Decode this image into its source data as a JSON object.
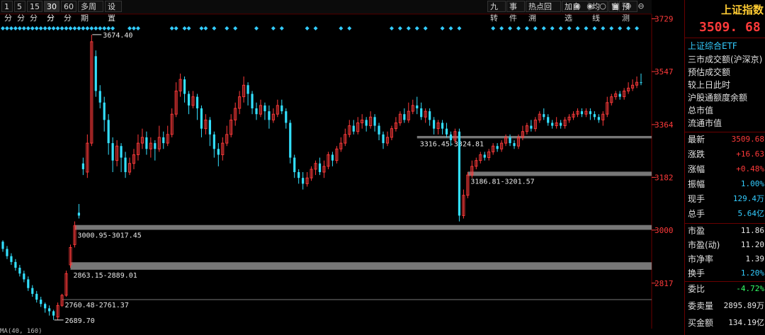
{
  "toolbar": {
    "periods": [
      "1分",
      "5分",
      "15分",
      "30分",
      "60分",
      "多周期",
      "设置"
    ],
    "right_tabs": [
      "九转",
      "事件",
      "热点回溯",
      "加自选",
      "均线",
      "窗",
      "预测"
    ],
    "icons": [
      "circle-dot-icon",
      "eye-icon",
      "circle-icon",
      "trash-icon",
      "plus-circle-icon",
      "minus-circle-icon"
    ]
  },
  "bottom_strip": "MA(40, 160)",
  "chart_data": {
    "type": "candlestick",
    "y_axis_ticks": [
      3729,
      3547,
      3364,
      3182,
      3000,
      2817
    ],
    "ylim": [
      2660,
      3745
    ],
    "candles": [
      [
        2960,
        2935,
        2965,
        2925
      ],
      [
        2935,
        2910,
        2945,
        2900
      ],
      [
        2910,
        2890,
        2920,
        2880
      ],
      [
        2890,
        2870,
        2900,
        2860
      ],
      [
        2870,
        2850,
        2880,
        2840
      ],
      [
        2850,
        2830,
        2860,
        2820
      ],
      [
        2830,
        2800,
        2840,
        2790
      ],
      [
        2800,
        2780,
        2810,
        2770
      ],
      [
        2780,
        2760,
        2790,
        2750
      ],
      [
        2760,
        2745,
        2770,
        2735
      ],
      [
        2745,
        2730,
        2750,
        2715
      ],
      [
        2730,
        2720,
        2740,
        2705
      ],
      [
        2720,
        2705,
        2725,
        2690
      ],
      [
        2700,
        2740,
        2750,
        2690
      ],
      [
        2740,
        2775,
        2780,
        2735
      ],
      [
        2775,
        2850,
        2860,
        2770
      ],
      [
        2880,
        2940,
        2950,
        2870
      ],
      [
        2950,
        3015,
        3030,
        2940
      ],
      [
        3060,
        3050,
        3090,
        3040
      ],
      [
        3230,
        3210,
        3250,
        3190
      ],
      [
        3200,
        3300,
        3330,
        3180
      ],
      [
        3300,
        3650,
        3674,
        3290
      ],
      [
        3600,
        3480,
        3620,
        3460
      ],
      [
        3480,
        3440,
        3500,
        3420
      ],
      [
        3440,
        3380,
        3460,
        3340
      ],
      [
        3380,
        3300,
        3400,
        3260
      ],
      [
        3300,
        3240,
        3320,
        3200
      ],
      [
        3240,
        3290,
        3310,
        3220
      ],
      [
        3290,
        3250,
        3300,
        3200
      ],
      [
        3250,
        3200,
        3270,
        3180
      ],
      [
        3200,
        3230,
        3250,
        3190
      ],
      [
        3230,
        3260,
        3280,
        3210
      ],
      [
        3260,
        3300,
        3330,
        3240
      ],
      [
        3300,
        3320,
        3350,
        3280
      ],
      [
        3320,
        3280,
        3340,
        3260
      ],
      [
        3280,
        3300,
        3320,
        3250
      ],
      [
        3300,
        3280,
        3310,
        3240
      ],
      [
        3280,
        3320,
        3360,
        3270
      ],
      [
        3320,
        3300,
        3340,
        3280
      ],
      [
        3300,
        3330,
        3360,
        3290
      ],
      [
        3330,
        3400,
        3420,
        3320
      ],
      [
        3400,
        3480,
        3510,
        3390
      ],
      [
        3480,
        3520,
        3540,
        3460
      ],
      [
        3520,
        3470,
        3530,
        3440
      ],
      [
        3470,
        3430,
        3480,
        3400
      ],
      [
        3430,
        3460,
        3480,
        3420
      ],
      [
        3460,
        3420,
        3470,
        3380
      ],
      [
        3420,
        3350,
        3430,
        3320
      ],
      [
        3350,
        3380,
        3400,
        3330
      ],
      [
        3380,
        3330,
        3390,
        3290
      ],
      [
        3330,
        3280,
        3340,
        3250
      ],
      [
        3280,
        3260,
        3300,
        3220
      ],
      [
        3260,
        3300,
        3320,
        3240
      ],
      [
        3300,
        3330,
        3360,
        3290
      ],
      [
        3330,
        3380,
        3400,
        3320
      ],
      [
        3380,
        3420,
        3440,
        3360
      ],
      [
        3420,
        3460,
        3480,
        3400
      ],
      [
        3460,
        3500,
        3530,
        3440
      ],
      [
        3500,
        3470,
        3510,
        3430
      ],
      [
        3470,
        3420,
        3480,
        3400
      ],
      [
        3420,
        3400,
        3440,
        3380
      ],
      [
        3400,
        3430,
        3450,
        3390
      ],
      [
        3430,
        3410,
        3440,
        3380
      ],
      [
        3410,
        3380,
        3430,
        3350
      ],
      [
        3380,
        3400,
        3420,
        3370
      ],
      [
        3400,
        3430,
        3450,
        3390
      ],
      [
        3430,
        3410,
        3450,
        3400
      ],
      [
        3410,
        3370,
        3420,
        3350
      ],
      [
        3370,
        3250,
        3380,
        3230
      ],
      [
        3250,
        3200,
        3260,
        3180
      ],
      [
        3200,
        3180,
        3210,
        3160
      ],
      [
        3180,
        3160,
        3200,
        3140
      ],
      [
        3160,
        3180,
        3200,
        3150
      ],
      [
        3180,
        3210,
        3220,
        3170
      ],
      [
        3210,
        3230,
        3240,
        3190
      ],
      [
        3230,
        3200,
        3250,
        3190
      ],
      [
        3200,
        3220,
        3240,
        3180
      ],
      [
        3220,
        3260,
        3270,
        3210
      ],
      [
        3260,
        3240,
        3270,
        3220
      ],
      [
        3240,
        3280,
        3290,
        3230
      ],
      [
        3280,
        3300,
        3320,
        3270
      ],
      [
        3300,
        3330,
        3350,
        3290
      ],
      [
        3330,
        3360,
        3380,
        3320
      ],
      [
        3360,
        3340,
        3380,
        3330
      ],
      [
        3340,
        3370,
        3390,
        3330
      ],
      [
        3370,
        3380,
        3400,
        3350
      ],
      [
        3380,
        3360,
        3390,
        3340
      ],
      [
        3360,
        3390,
        3410,
        3350
      ],
      [
        3390,
        3360,
        3400,
        3340
      ],
      [
        3360,
        3330,
        3370,
        3310
      ],
      [
        3330,
        3300,
        3340,
        3280
      ],
      [
        3300,
        3320,
        3340,
        3290
      ],
      [
        3320,
        3350,
        3360,
        3310
      ],
      [
        3350,
        3370,
        3390,
        3340
      ],
      [
        3370,
        3400,
        3410,
        3360
      ],
      [
        3400,
        3380,
        3420,
        3370
      ],
      [
        3380,
        3410,
        3440,
        3370
      ],
      [
        3410,
        3430,
        3450,
        3400
      ],
      [
        3430,
        3420,
        3460,
        3400
      ],
      [
        3420,
        3390,
        3440,
        3380
      ],
      [
        3390,
        3410,
        3420,
        3370
      ],
      [
        3410,
        3380,
        3420,
        3360
      ],
      [
        3380,
        3350,
        3390,
        3330
      ],
      [
        3350,
        3370,
        3380,
        3330
      ],
      [
        3370,
        3350,
        3380,
        3330
      ],
      [
        3350,
        3330,
        3370,
        3320
      ],
      [
        3330,
        3310,
        3340,
        3290
      ],
      [
        3310,
        3340,
        3350,
        3300
      ],
      [
        3340,
        3050,
        3350,
        3030
      ],
      [
        3050,
        3120,
        3140,
        3040
      ],
      [
        3120,
        3190,
        3200,
        3110
      ],
      [
        3190,
        3220,
        3240,
        3180
      ],
      [
        3220,
        3240,
        3250,
        3210
      ],
      [
        3240,
        3260,
        3270,
        3230
      ],
      [
        3260,
        3250,
        3270,
        3240
      ],
      [
        3250,
        3270,
        3280,
        3240
      ],
      [
        3270,
        3290,
        3300,
        3260
      ],
      [
        3290,
        3280,
        3300,
        3270
      ],
      [
        3280,
        3300,
        3310,
        3270
      ],
      [
        3300,
        3320,
        3330,
        3290
      ],
      [
        3320,
        3300,
        3330,
        3290
      ],
      [
        3300,
        3290,
        3310,
        3280
      ],
      [
        3290,
        3320,
        3330,
        3280
      ],
      [
        3320,
        3340,
        3360,
        3310
      ],
      [
        3340,
        3360,
        3370,
        3330
      ],
      [
        3360,
        3350,
        3380,
        3340
      ],
      [
        3350,
        3380,
        3390,
        3340
      ],
      [
        3380,
        3400,
        3410,
        3370
      ],
      [
        3400,
        3390,
        3420,
        3380
      ],
      [
        3390,
        3370,
        3400,
        3360
      ],
      [
        3370,
        3360,
        3380,
        3350
      ],
      [
        3360,
        3370,
        3390,
        3350
      ],
      [
        3370,
        3360,
        3380,
        3350
      ],
      [
        3360,
        3380,
        3390,
        3350
      ],
      [
        3380,
        3390,
        3400,
        3370
      ],
      [
        3390,
        3400,
        3410,
        3380
      ],
      [
        3400,
        3410,
        3420,
        3390
      ],
      [
        3410,
        3400,
        3420,
        3390
      ],
      [
        3400,
        3410,
        3420,
        3390
      ],
      [
        3410,
        3400,
        3420,
        3380
      ],
      [
        3400,
        3390,
        3410,
        3380
      ],
      [
        3390,
        3380,
        3400,
        3370
      ],
      [
        3380,
        3400,
        3410,
        3360
      ],
      [
        3400,
        3440,
        3460,
        3390
      ],
      [
        3440,
        3460,
        3470,
        3430
      ],
      [
        3460,
        3470,
        3480,
        3450
      ],
      [
        3470,
        3460,
        3480,
        3450
      ],
      [
        3460,
        3480,
        3490,
        3450
      ],
      [
        3480,
        3490,
        3510,
        3470
      ],
      [
        3490,
        3500,
        3520,
        3480
      ],
      [
        3500,
        3510,
        3530,
        3490
      ],
      [
        3510,
        3509.68,
        3540,
        3500
      ]
    ],
    "annotations": [
      {
        "price": 3674.4,
        "label": "3674.40"
      },
      {
        "price": 2689.7,
        "label": "2689.70"
      }
    ],
    "gap_bands": [
      {
        "low": 3316.45,
        "high": 3324.81,
        "label": "3316.45-3324.81"
      },
      {
        "low": 3186.81,
        "high": 3201.57,
        "label": "3186.81-3201.57"
      },
      {
        "low": 3000.95,
        "high": 3017.45,
        "label": "3000.95-3017.45"
      },
      {
        "low": 2863.15,
        "high": 2889.01,
        "label": "2863.15-2889.01"
      },
      {
        "low": 2760.48,
        "high": 2761.37,
        "label": "2760.48-2761.37"
      }
    ],
    "signal_row_indices": [
      0,
      1,
      2,
      3,
      4,
      5,
      6,
      7,
      8,
      9,
      10,
      11,
      12,
      13,
      14,
      15,
      16,
      17,
      18,
      19,
      20,
      21,
      22,
      23,
      24,
      25,
      26,
      30,
      31,
      32,
      40,
      41,
      43,
      44,
      47,
      48,
      50,
      53,
      55,
      60,
      64,
      66,
      72,
      74,
      80,
      82,
      92,
      94,
      96,
      98,
      100,
      104,
      106,
      108,
      116,
      118,
      120,
      122,
      124,
      126,
      128,
      130,
      132,
      134,
      136,
      138,
      140,
      142,
      144,
      146,
      148,
      150,
      152,
      154,
      156,
      158,
      160,
      162,
      166,
      170,
      174,
      178,
      182
    ]
  },
  "panel": {
    "title": "上证指数",
    "price": "3509. 68",
    "etf": "上证综合ETF",
    "items": [
      "三市成交额(沪深京)",
      "预估成交额",
      "较上日此时",
      "沪股通额度余额",
      "总市值",
      "流通市值"
    ],
    "quotes": [
      {
        "k": "最新",
        "v": "3509.68",
        "c": "red"
      },
      {
        "k": "涨跌",
        "v": "+16.63",
        "c": "red"
      },
      {
        "k": "涨幅",
        "v": "+0.48%",
        "c": "red"
      },
      {
        "k": "振幅",
        "v": "1.00%",
        "c": "cyan"
      },
      {
        "k": "现手",
        "v": "129.4万",
        "c": "cyan"
      },
      {
        "k": "总手",
        "v": "5.64亿",
        "c": "cyan"
      }
    ],
    "valuation": [
      {
        "k": "市盈",
        "v": "11.86",
        "c": "white"
      },
      {
        "k": "市盈(动)",
        "v": "11.20",
        "c": "white"
      },
      {
        "k": "市净率",
        "v": "1.39",
        "c": "white"
      },
      {
        "k": "换手",
        "v": "1.20%",
        "c": "cyan"
      }
    ],
    "orders": [
      {
        "k": "委比",
        "v": "-4.72%",
        "c": "green"
      },
      {
        "k": "委卖量",
        "v": "2895.89万",
        "c": "white"
      },
      {
        "k": "买金额",
        "v": "134.19亿",
        "c": "white"
      }
    ]
  },
  "colors": {
    "up": "#ff3a3a",
    "down": "#33e0ff",
    "band": "#8c8c8c",
    "signal": "#33ccff"
  }
}
